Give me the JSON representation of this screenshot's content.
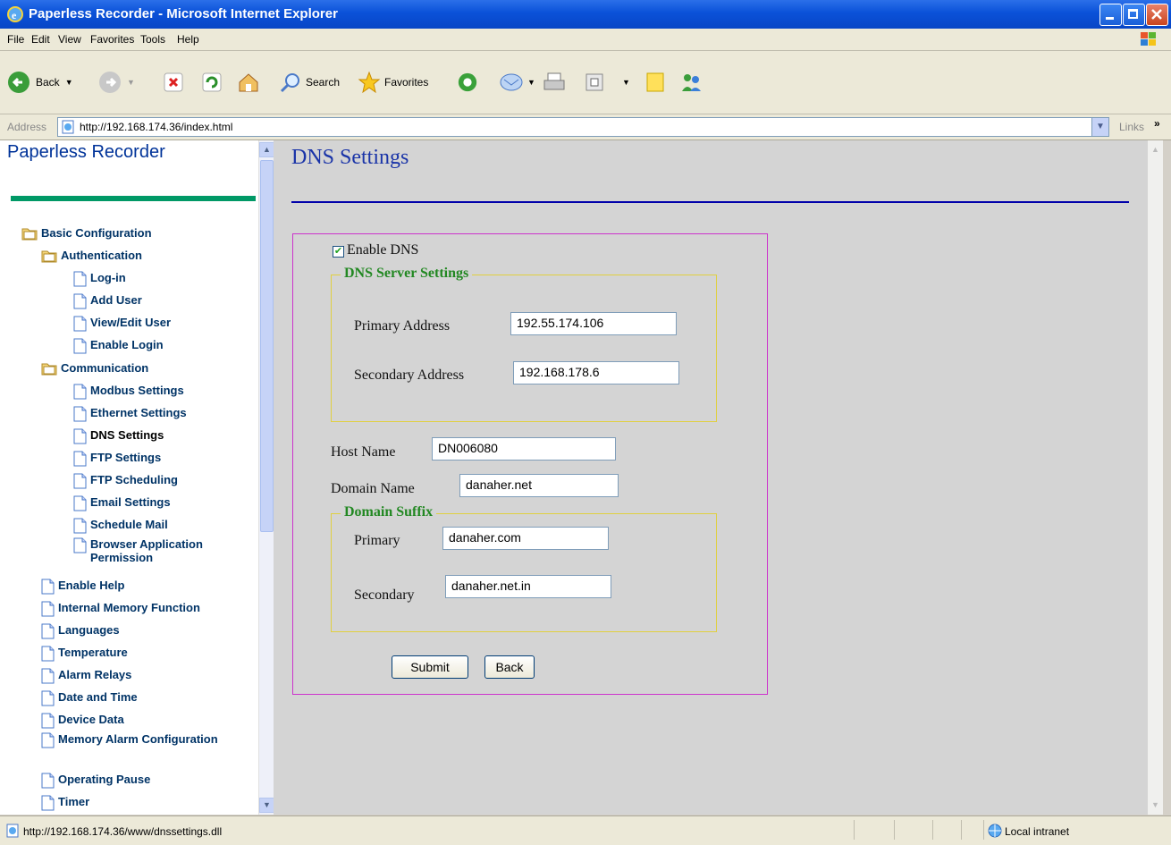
{
  "window": {
    "title": "Paperless Recorder - Microsoft Internet Explorer"
  },
  "menu": [
    "File",
    "Edit",
    "View",
    "Favorites",
    "Tools",
    "Help"
  ],
  "toolbar": {
    "back": "Back",
    "search": "Search",
    "favorites": "Favorites"
  },
  "address": {
    "label": "Address",
    "url": "http://192.168.174.36/index.html",
    "links": "Links"
  },
  "sidebar": {
    "title": "Paperless Recorder",
    "items": [
      {
        "label": "Basic Configuration",
        "type": "folder"
      },
      {
        "label": "Authentication",
        "type": "folder"
      },
      {
        "label": "Log-in",
        "type": "doc"
      },
      {
        "label": "Add User",
        "type": "doc"
      },
      {
        "label": "View/Edit User",
        "type": "doc"
      },
      {
        "label": "Enable Login",
        "type": "doc"
      },
      {
        "label": "Communication",
        "type": "folder"
      },
      {
        "label": "Modbus Settings",
        "type": "doc"
      },
      {
        "label": "Ethernet Settings",
        "type": "doc"
      },
      {
        "label": "DNS Settings",
        "type": "doc",
        "active": true
      },
      {
        "label": "FTP Settings",
        "type": "doc"
      },
      {
        "label": "FTP Scheduling",
        "type": "doc"
      },
      {
        "label": "Email Settings",
        "type": "doc"
      },
      {
        "label": "Schedule Mail",
        "type": "doc"
      },
      {
        "label": "Browser Application Permission",
        "type": "doc"
      },
      {
        "label": "Enable Help",
        "type": "doc"
      },
      {
        "label": "Internal Memory Function",
        "type": "doc"
      },
      {
        "label": "Languages",
        "type": "doc"
      },
      {
        "label": "Temperature",
        "type": "doc"
      },
      {
        "label": "Alarm Relays",
        "type": "doc"
      },
      {
        "label": "Date and Time",
        "type": "doc"
      },
      {
        "label": "Device Data",
        "type": "doc"
      },
      {
        "label": "Memory Alarm Configuration",
        "type": "doc"
      },
      {
        "label": "Operating Pause",
        "type": "doc"
      },
      {
        "label": "Timer",
        "type": "doc"
      }
    ]
  },
  "main": {
    "title": "DNS Settings",
    "enable_dns": {
      "label": "Enable DNS",
      "checked": true
    },
    "dns_server": {
      "legend": "DNS Server Settings",
      "primary_label": "Primary Address",
      "primary_value": "192.55.174.106",
      "secondary_label": "Secondary Address",
      "secondary_value": "192.168.178.6"
    },
    "host_name": {
      "label": "Host Name",
      "value": "DN006080"
    },
    "domain_name": {
      "label": "Domain Name",
      "value": "danaher.net"
    },
    "domain_suffix": {
      "legend": "Domain Suffix",
      "primary_label": "Primary",
      "primary_value": "danaher.com",
      "secondary_label": "Secondary",
      "secondary_value": "danaher.net.in"
    },
    "submit_label": "Submit",
    "back_label": "Back"
  },
  "status": {
    "url": "http://192.168.174.36/www/dnssettings.dll",
    "zone": "Local intranet"
  }
}
